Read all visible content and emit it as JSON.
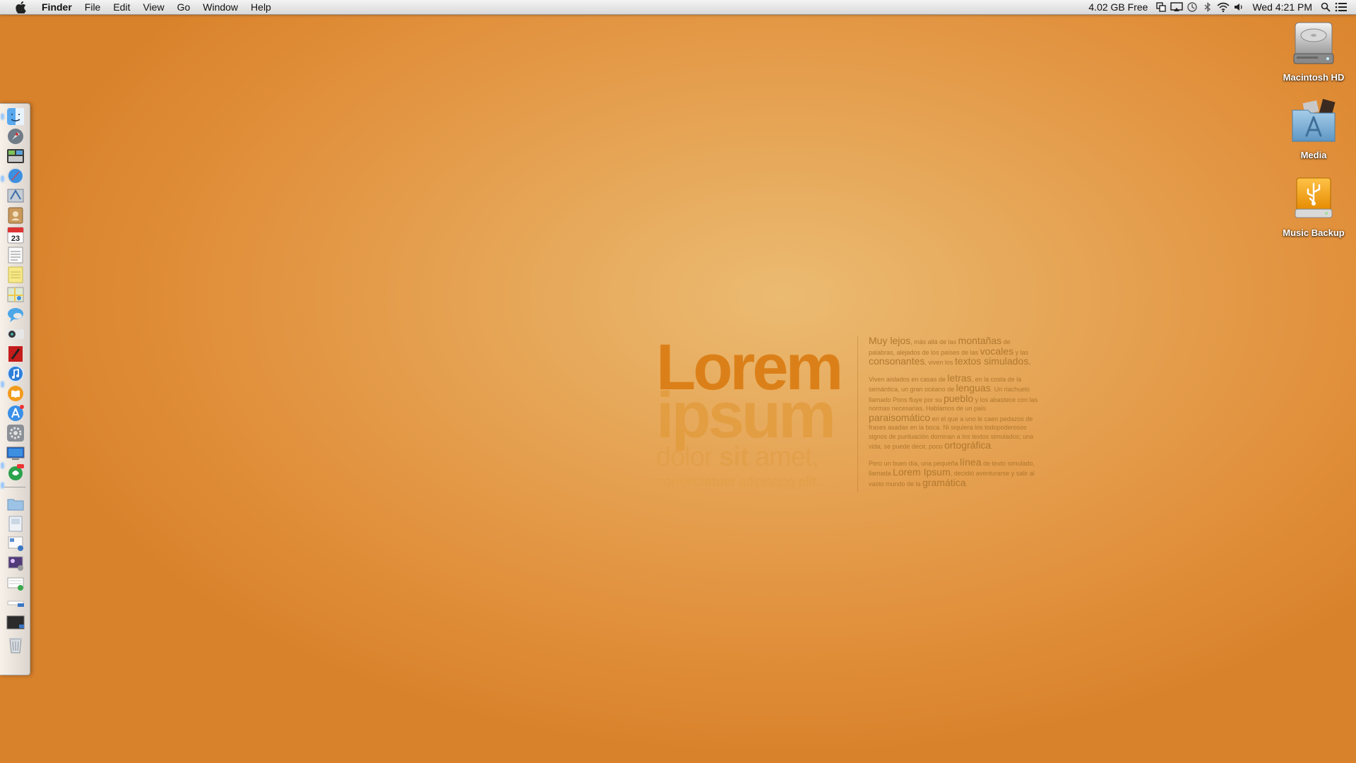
{
  "menubar": {
    "app_name": "Finder",
    "menus": [
      "File",
      "Edit",
      "View",
      "Go",
      "Window",
      "Help"
    ],
    "disk_free": "4.02 GB Free",
    "clock": "Wed 4:21 PM"
  },
  "desktop_icons": [
    {
      "label": "Macintosh HD",
      "icon": "hard-drive-icon"
    },
    {
      "label": "Media",
      "icon": "applications-folder-icon"
    },
    {
      "label": "Music Backup",
      "icon": "usb-drive-icon"
    }
  ],
  "dock": {
    "calendar_day": "23",
    "items": [
      "finder-icon",
      "launchpad-icon",
      "mission-control-icon",
      "safari-icon",
      "mail-icon",
      "contacts-icon",
      "calendar-icon",
      "reminders-icon",
      "notes-icon",
      "maps-icon",
      "messages-icon",
      "facetime-icon",
      "photobooth-icon",
      "itunes-icon",
      "ibooks-icon",
      "app-store-icon",
      "system-preferences-icon",
      "screen-icon",
      "app-icon",
      "folder-icon",
      "document-icon",
      "downloads-stack-icon",
      "images-stack-icon",
      "documents-stack-icon",
      "drive-stack-icon",
      "terminal-icon",
      "trash-icon"
    ]
  },
  "wallpaper": {
    "title_1": "Lorem",
    "title_2": "ipsum",
    "line_3a": "dolor ",
    "line_3b": "sit",
    "line_3c": " amet,",
    "line_4a": "consectetuer",
    "line_4b": " adipiscing ",
    "line_4c": "elit.",
    "para_1a": "Muy lejos",
    "para_1b": ", más allá de las ",
    "para_1c": "montañas",
    "para_1d": " de palabras, alejados de los países de las ",
    "para_1e": "vocales",
    "para_1f": " y las ",
    "para_1g": "consonantes",
    "para_1h": ", viven los ",
    "para_1i": "textos simulados.",
    "para_2a": "Viven aislados en casas de ",
    "para_2b": "letras",
    "para_2c": ", en la costa de la semántica, un gran océano de ",
    "para_2d": "lenguas",
    "para_2e": ". Un riachuelo llamado Pons fluye por su ",
    "para_2f": "pueblo",
    "para_2g": " y los abastece con las normas necesarias. Hablamos de un país ",
    "para_2h": "paraisomático",
    "para_2i": " en el que a uno le caen pedazos de frases asadas en la boca. Ni siquiera los todopoderosos signos de puntuación dominan a los textos simulados; una vida, se puede decir, poco ",
    "para_2j": "ortográfica",
    "para_2k": ".",
    "para_3a": "Pero un buen día, una pequeña ",
    "para_3b": "línea",
    "para_3c": " de texto simulado, llamada ",
    "para_3d": "Lorem Ipsum",
    "para_3e": ", decidió aventurarse y salir al vasto mundo de la ",
    "para_3f": "gramática",
    "para_3g": "."
  }
}
